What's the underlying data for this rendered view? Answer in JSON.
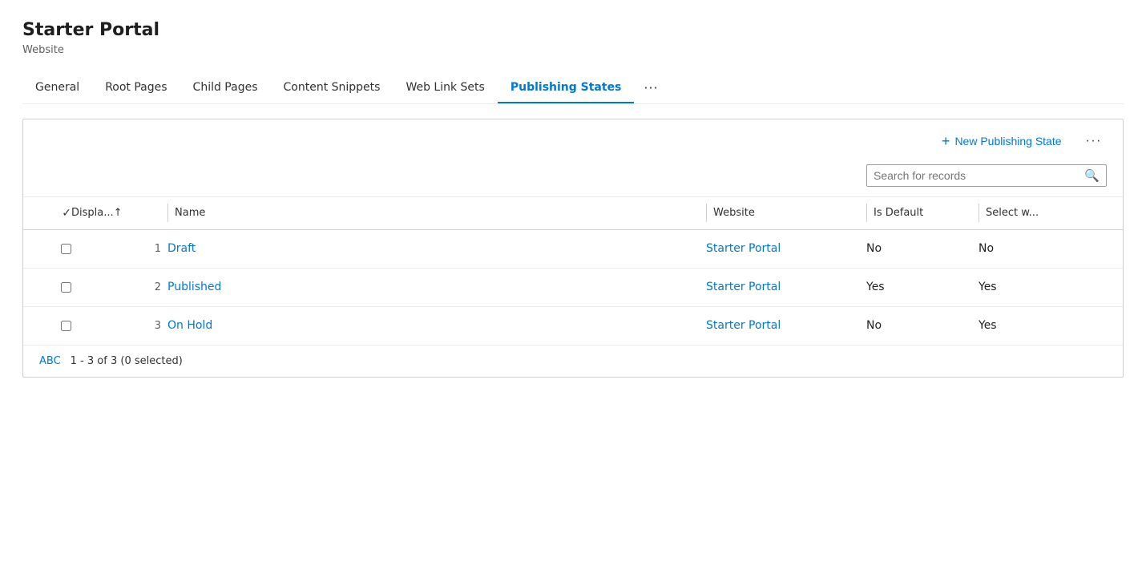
{
  "header": {
    "title": "Starter Portal",
    "subtitle": "Website"
  },
  "tabs": [
    {
      "id": "general",
      "label": "General",
      "active": false
    },
    {
      "id": "root-pages",
      "label": "Root Pages",
      "active": false
    },
    {
      "id": "child-pages",
      "label": "Child Pages",
      "active": false
    },
    {
      "id": "content-snippets",
      "label": "Content Snippets",
      "active": false
    },
    {
      "id": "web-link-sets",
      "label": "Web Link Sets",
      "active": false
    },
    {
      "id": "publishing-states",
      "label": "Publishing States",
      "active": true
    }
  ],
  "more_tabs_icon": "···",
  "toolbar": {
    "new_btn_icon": "+",
    "new_btn_label": "New Publishing State",
    "more_icon": "···"
  },
  "search": {
    "placeholder": "Search for records"
  },
  "table": {
    "columns": [
      {
        "id": "check",
        "label": ""
      },
      {
        "id": "display",
        "label": "Displa...↑",
        "sortable": true
      },
      {
        "id": "name",
        "label": "Name"
      },
      {
        "id": "website",
        "label": "Website"
      },
      {
        "id": "is_default",
        "label": "Is Default"
      },
      {
        "id": "select_w",
        "label": "Select w..."
      }
    ],
    "rows": [
      {
        "num": "1",
        "name": "Draft",
        "website": "Starter Portal",
        "is_default": "No",
        "select_w": "No"
      },
      {
        "num": "2",
        "name": "Published",
        "website": "Starter Portal",
        "is_default": "Yes",
        "select_w": "Yes"
      },
      {
        "num": "3",
        "name": "On Hold",
        "website": "Starter Portal",
        "is_default": "No",
        "select_w": "Yes"
      }
    ]
  },
  "pagination": {
    "abc_label": "ABC",
    "info": "1 - 3 of 3 (0 selected)"
  },
  "colors": {
    "accent_blue": "#0078d4",
    "active_tab_underline": "#0078d4"
  }
}
